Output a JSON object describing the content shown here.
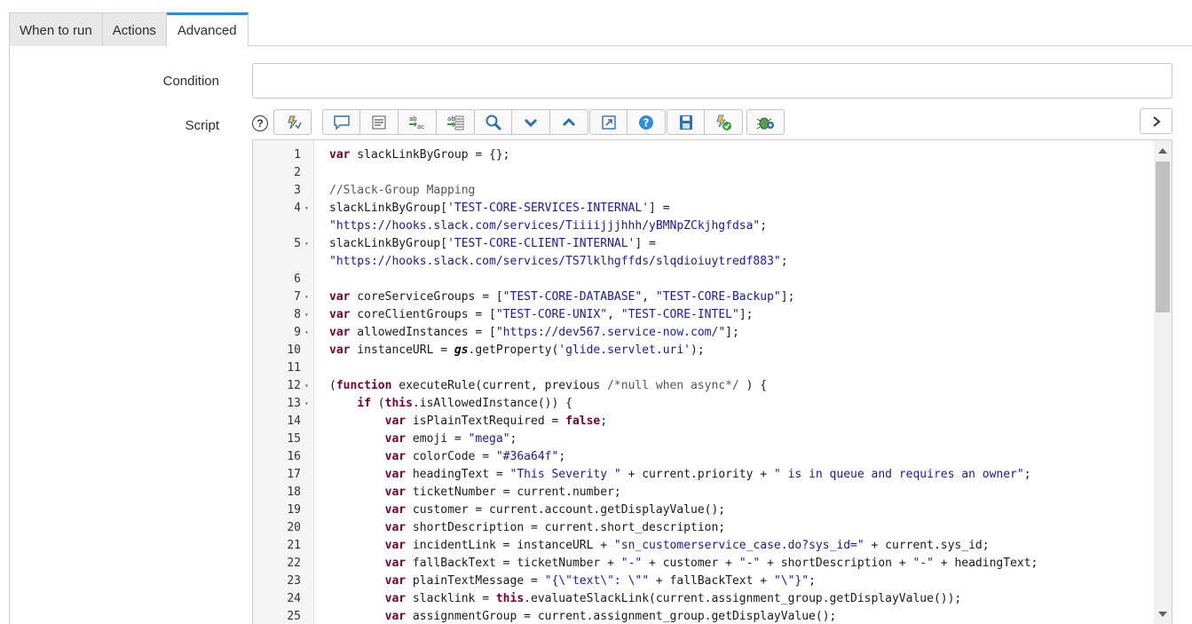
{
  "tabs": [
    {
      "label": "When to run"
    },
    {
      "label": "Actions"
    },
    {
      "label": "Advanced"
    }
  ],
  "form": {
    "condition_label": "Condition",
    "condition_value": "",
    "script_label": "Script",
    "help_glyph": "?"
  },
  "toolbar": {
    "accent": "#2f8fd6",
    "groups": [
      [
        "format-code-icon"
      ],
      [
        "toggle-comment-icon",
        "insert-fields-icon",
        "replace-icon",
        "replace-all-icon"
      ],
      [
        "search-icon",
        "find-next-icon",
        "find-previous-icon"
      ],
      [
        "fullscreen-icon",
        "help-circle-icon"
      ],
      [
        "save-icon",
        "syntax-check-icon"
      ],
      [
        "debug-icon"
      ]
    ]
  },
  "editor": {
    "lines": [
      {
        "n": "1",
        "fold": "",
        "code": "var slackLinkByGroup = {};"
      },
      {
        "n": "2",
        "fold": "",
        "code": ""
      },
      {
        "n": "3",
        "fold": "",
        "code": "//Slack-Group Mapping"
      },
      {
        "n": "4",
        "fold": "▾",
        "code": "slackLinkByGroup['TEST-CORE-SERVICES-INTERNAL'] ="
      },
      {
        "n": "",
        "fold": "",
        "code": "\"https://hooks.slack.com/services/Tiiiijjjhhh/yBMNpZCkjhgfdsa\";"
      },
      {
        "n": "5",
        "fold": "▾",
        "code": "slackLinkByGroup['TEST-CORE-CLIENT-INTERNAL'] ="
      },
      {
        "n": "",
        "fold": "",
        "code": "\"https://hooks.slack.com/services/TS7lklhgffds/slqdioiuytredf883\";"
      },
      {
        "n": "6",
        "fold": "",
        "code": ""
      },
      {
        "n": "7",
        "fold": "▾",
        "code": "var coreServiceGroups = [\"TEST-CORE-DATABASE\", \"TEST-CORE-Backup\"];"
      },
      {
        "n": "8",
        "fold": "▾",
        "code": "var coreClientGroups = [\"TEST-CORE-UNIX\", \"TEST-CORE-INTEL\"];"
      },
      {
        "n": "9",
        "fold": "▾",
        "code": "var allowedInstances = [\"https://dev567.service-now.com/\"];"
      },
      {
        "n": "10",
        "fold": "",
        "code": "var instanceURL = gs.getProperty('glide.servlet.uri');"
      },
      {
        "n": "11",
        "fold": "",
        "code": ""
      },
      {
        "n": "12",
        "fold": "▾",
        "code": "(function executeRule(current, previous /*null when async*/ ) {"
      },
      {
        "n": "13",
        "fold": "▾",
        "code": "    if (this.isAllowedInstance()) {"
      },
      {
        "n": "14",
        "fold": "",
        "code": "        var isPlainTextRequired = false;"
      },
      {
        "n": "15",
        "fold": "",
        "code": "        var emoji = \"mega\";"
      },
      {
        "n": "16",
        "fold": "",
        "code": "        var colorCode = \"#36a64f\";"
      },
      {
        "n": "17",
        "fold": "",
        "code": "        var headingText = \"This Severity \" + current.priority + \" is in queue and requires an owner\";"
      },
      {
        "n": "18",
        "fold": "",
        "code": "        var ticketNumber = current.number;"
      },
      {
        "n": "19",
        "fold": "",
        "code": "        var customer = current.account.getDisplayValue();"
      },
      {
        "n": "20",
        "fold": "",
        "code": "        var shortDescription = current.short_description;"
      },
      {
        "n": "21",
        "fold": "",
        "code": "        var incidentLink = instanceURL + \"sn_customerservice_case.do?sys_id=\" + current.sys_id;"
      },
      {
        "n": "22",
        "fold": "",
        "code": "        var fallBackText = ticketNumber + \"-\" + customer + \"-\" + shortDescription + \"-\" + headingText;"
      },
      {
        "n": "23",
        "fold": "",
        "code": "        var plainTextMessage = \"{\\\"text\\\": \\\"\" + fallBackText + \"\\\"}\";"
      },
      {
        "n": "24",
        "fold": "",
        "code": "        var slacklink = this.evaluateSlackLink(current.assignment_group.getDisplayValue());"
      },
      {
        "n": "25",
        "fold": "",
        "code": "        var assignmentGroup = current.assignment_group.getDisplayValue();"
      }
    ]
  }
}
